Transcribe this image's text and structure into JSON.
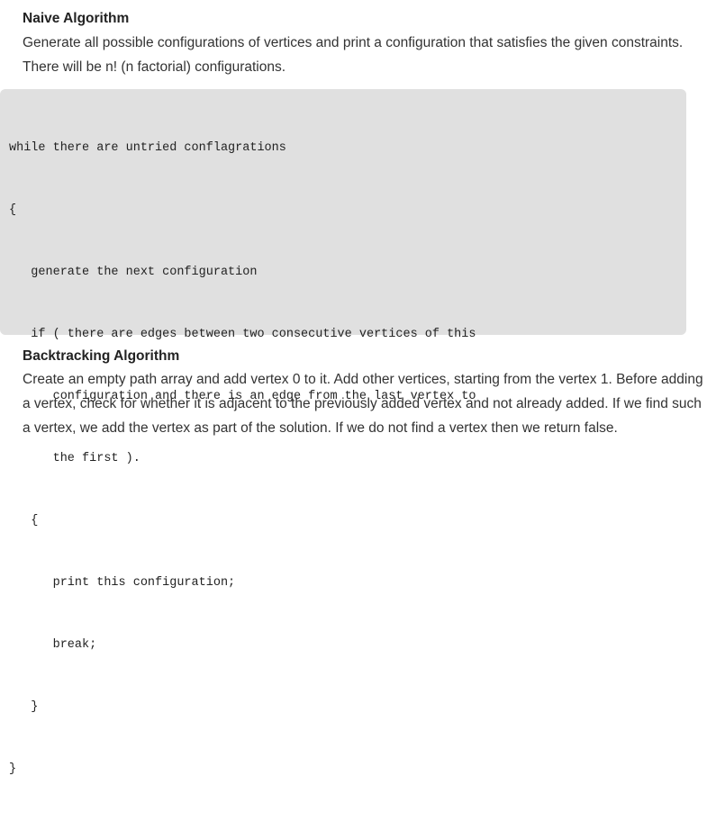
{
  "naive": {
    "heading": "Naive Algorithm",
    "paragraph": "Generate all possible configurations of vertices and print a configuration that satisfies the given constraints. There will be n! (n factorial) configurations."
  },
  "code": {
    "lines": [
      "while there are untried conflagrations",
      "{",
      "   generate the next configuration",
      "   if ( there are edges between two consecutive vertices of this",
      "      configuration and there is an edge from the last vertex to",
      "      the first ).",
      "   {",
      "      print this configuration;",
      "      break;",
      "   }",
      "}"
    ]
  },
  "backtracking": {
    "heading": "Backtracking Algorithm",
    "paragraph": "Create an empty path array and add vertex 0 to it. Add other vertices, starting from the vertex 1. Before adding a vertex, check for whether it is adjacent to the previously added vertex and not already added. If we find such a vertex, we add the vertex as part of the solution. If we do not find a vertex then we return false."
  }
}
